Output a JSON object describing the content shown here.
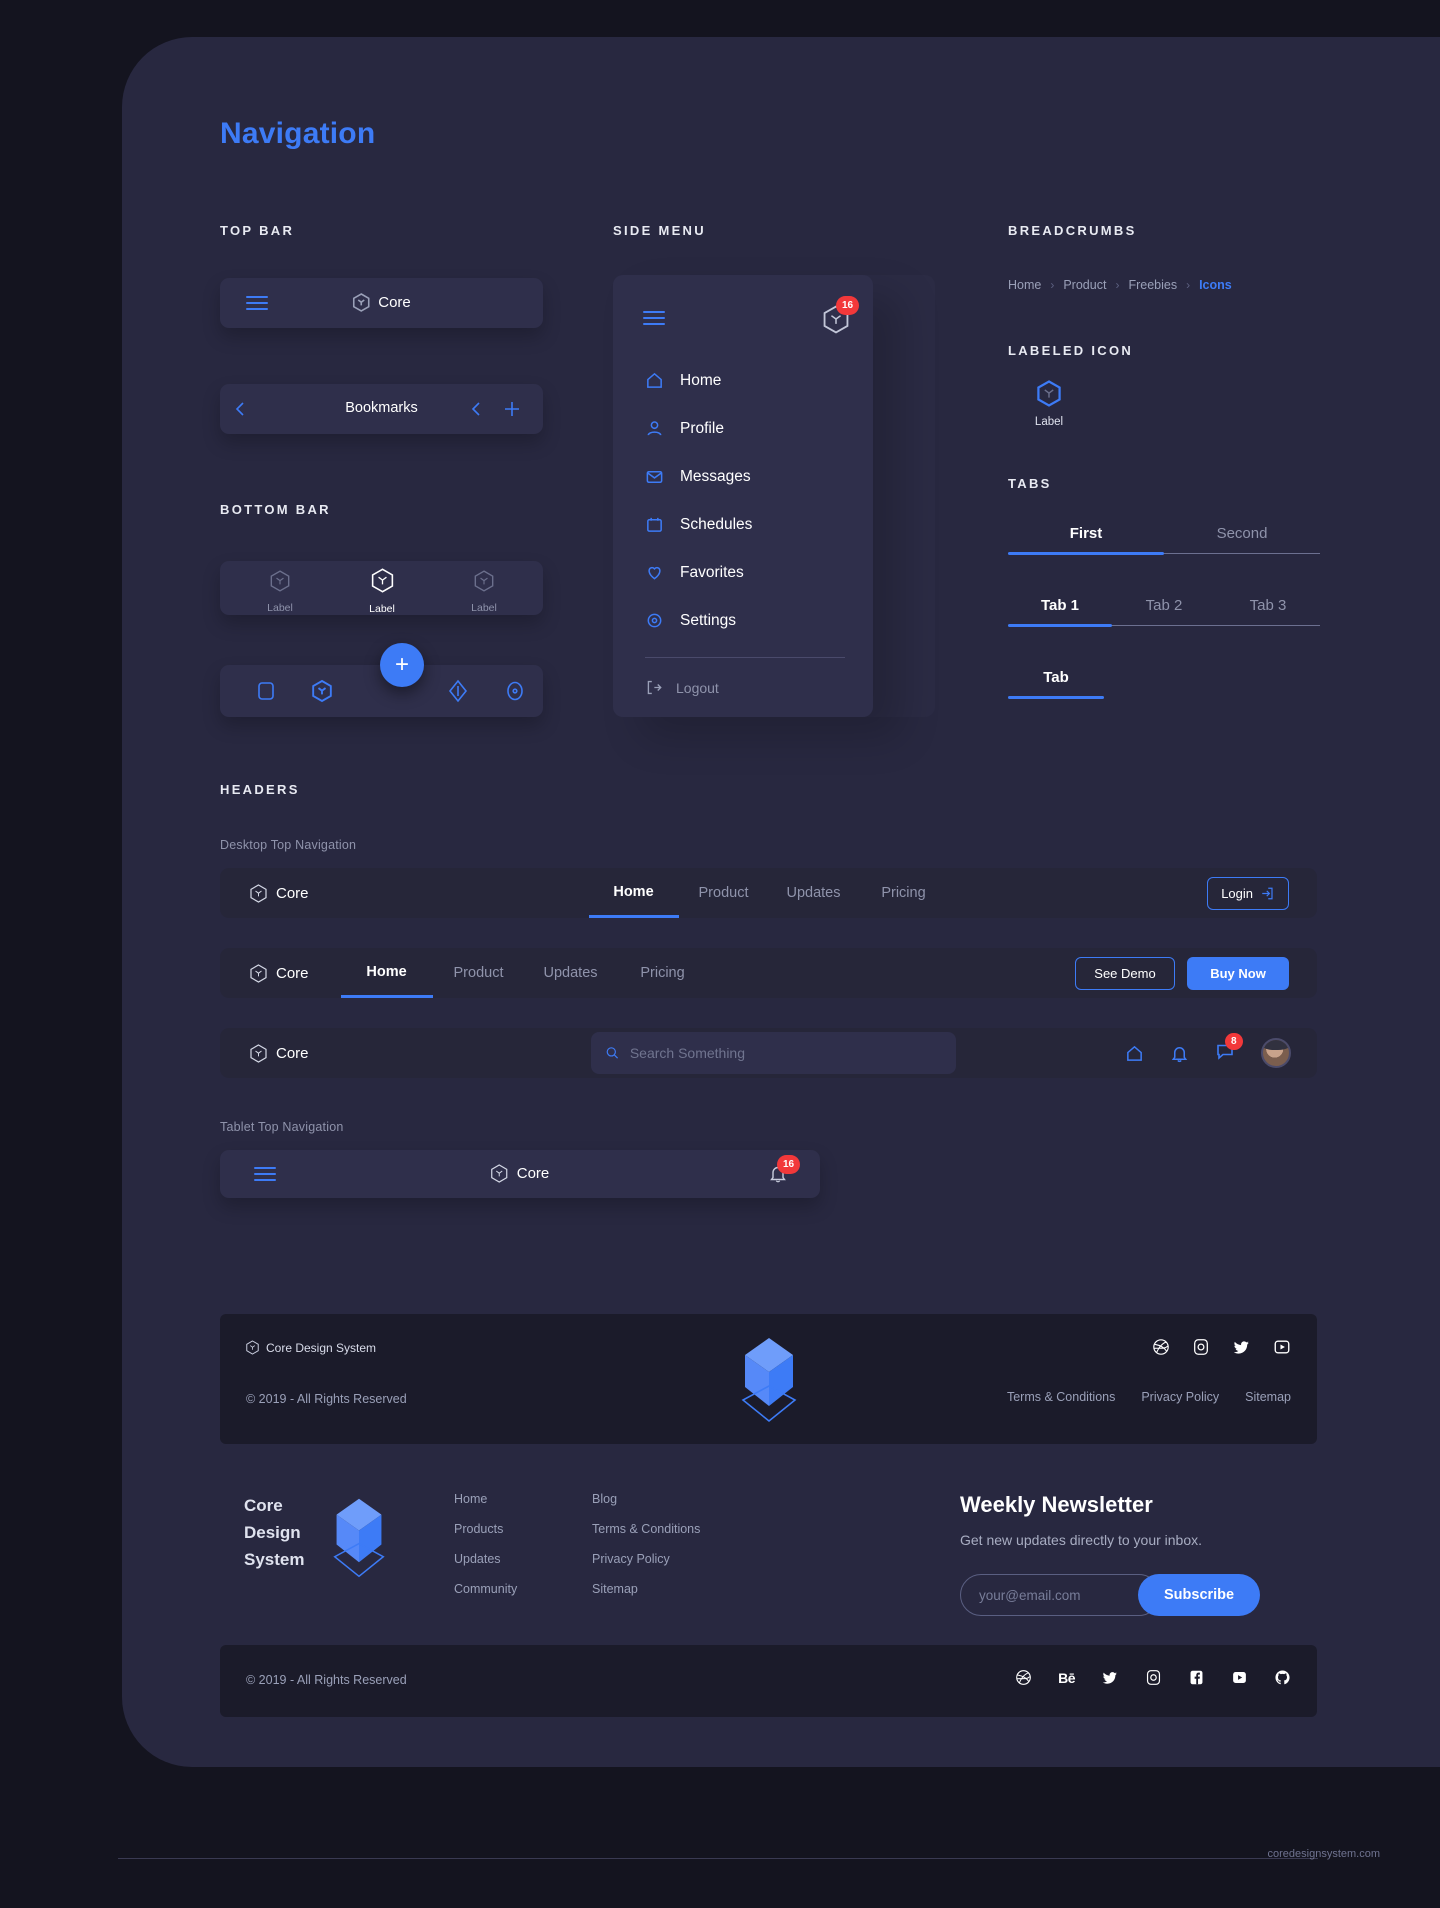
{
  "page": {
    "title": "Navigation",
    "site_url": "coredesignsystem.com"
  },
  "sections": {
    "top_bar": "TOP BAR",
    "side_menu": "SIDE MENU",
    "breadcrumbs": "BREADCRUMBS",
    "labeled_icon": "LABELED ICON",
    "tabs": "TABS",
    "bottom_bar": "BOTTOM BAR",
    "headers": "HEADERS"
  },
  "top_bar": {
    "bar1": {
      "brand": "Core",
      "menu_icon": "hamburger-icon"
    },
    "bar2": {
      "title": "Bookmarks",
      "back_icon": "chevron-left-icon",
      "add_icon": "plus-icon"
    }
  },
  "bottom_bar": {
    "labeled": [
      {
        "label": "Label",
        "active": false
      },
      {
        "label": "Label",
        "active": true
      },
      {
        "label": "Label",
        "active": false
      }
    ],
    "icons": [
      "rounded-square-icon",
      "hexagon-icon",
      "diamond-icon",
      "circle-icon"
    ],
    "fab_label": "+"
  },
  "side_menu": {
    "menu_icon": "hamburger-icon",
    "notification_badge": "16",
    "items": [
      {
        "label": "Home",
        "icon": "home-icon"
      },
      {
        "label": "Profile",
        "icon": "user-icon"
      },
      {
        "label": "Messages",
        "icon": "mail-icon"
      },
      {
        "label": "Schedules",
        "icon": "calendar-icon"
      },
      {
        "label": "Favorites",
        "icon": "heart-icon"
      },
      {
        "label": "Settings",
        "icon": "gear-icon"
      }
    ],
    "logout": {
      "label": "Logout",
      "icon": "logout-icon"
    }
  },
  "breadcrumbs": {
    "items": [
      {
        "label": "Home",
        "active": false
      },
      {
        "label": "Product",
        "active": false
      },
      {
        "label": "Freebies",
        "active": false
      },
      {
        "label": "Icons",
        "active": true
      }
    ],
    "separator": "›"
  },
  "labeled_icon": {
    "label": "Label",
    "icon": "hexagon-icon"
  },
  "tabs": {
    "row1": [
      {
        "label": "First",
        "active": true
      },
      {
        "label": "Second",
        "active": false
      }
    ],
    "row2": [
      {
        "label": "Tab 1",
        "active": true
      },
      {
        "label": "Tab 2",
        "active": false
      },
      {
        "label": "Tab 3",
        "active": false
      }
    ],
    "row3": [
      {
        "label": "Tab",
        "active": true
      }
    ]
  },
  "headers": {
    "desktop_caption": "Desktop Top Navigation",
    "tablet_caption": "Tablet Top Navigation",
    "nav1": {
      "brand": "Core",
      "links": [
        {
          "label": "Home",
          "active": true
        },
        {
          "label": "Product",
          "active": false
        },
        {
          "label": "Updates",
          "active": false
        },
        {
          "label": "Pricing",
          "active": false
        }
      ],
      "login_label": "Login",
      "login_icon": "logout-icon"
    },
    "nav2": {
      "brand": "Core",
      "links": [
        {
          "label": "Home",
          "active": true
        },
        {
          "label": "Product",
          "active": false
        },
        {
          "label": "Updates",
          "active": false
        },
        {
          "label": "Pricing",
          "active": false
        }
      ],
      "demo_label": "See Demo",
      "buy_label": "Buy Now"
    },
    "nav3": {
      "brand": "Core",
      "search_placeholder": "Search Something",
      "search_value": "",
      "icons": [
        "home-icon",
        "bell-icon",
        "chat-icon",
        "avatar"
      ],
      "chat_badge": "8"
    },
    "tablet": {
      "brand": "Core",
      "menu_icon": "hamburger-icon",
      "bell_icon": "bell-icon",
      "badge": "16"
    }
  },
  "footer_compact": {
    "brand": "Core Design System",
    "copyright": "© 2019 - All Rights Reserved",
    "social": [
      "dribbble-icon",
      "instagram-icon",
      "twitter-icon",
      "youtube-icon"
    ],
    "links": [
      "Terms & Conditions",
      "Privacy Policy",
      "Sitemap"
    ]
  },
  "footer_full": {
    "brand_lines": [
      "Core",
      "Design",
      "System"
    ],
    "col1": [
      "Home",
      "Products",
      "Updates",
      "Community"
    ],
    "col2": [
      "Blog",
      "Terms & Conditions",
      "Privacy Policy",
      "Sitemap"
    ],
    "newsletter": {
      "heading": "Weekly Newsletter",
      "subtext": "Get new updates directly to your inbox.",
      "email_placeholder": "your@email.com",
      "email_value": "",
      "button": "Subscribe"
    },
    "copyright": "© 2019 - All Rights Reserved",
    "social": [
      "dribbble-icon",
      "behance-icon",
      "twitter-icon",
      "instagram-icon",
      "facebook-icon",
      "youtube-icon",
      "github-icon"
    ]
  },
  "colors": {
    "accent": "#3d7bf6",
    "badge": "#f2383a",
    "panel": "#2f2f4b",
    "bg": "#282840",
    "dark": "#1b1b2a"
  }
}
